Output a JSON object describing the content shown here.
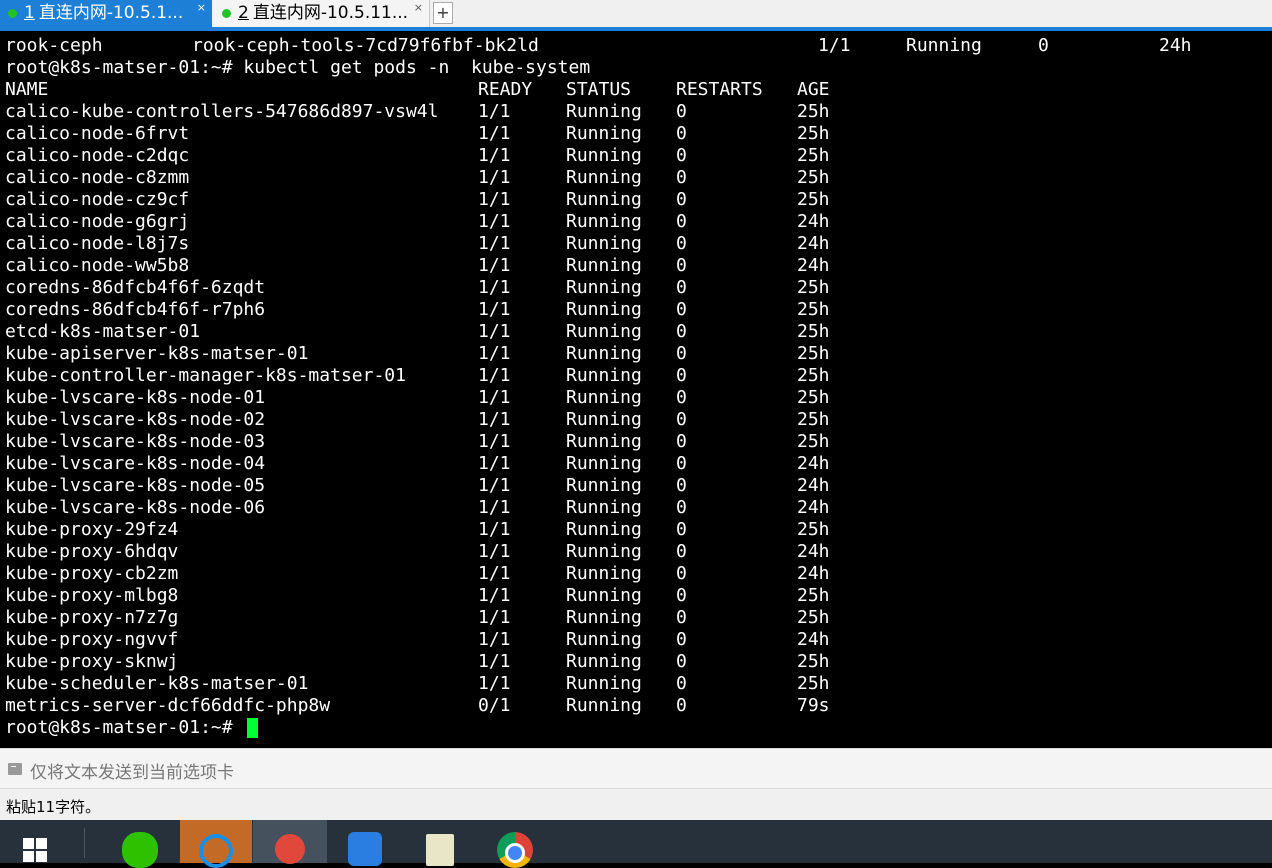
{
  "tabs": [
    {
      "num": "1",
      "title": "直连内网-10.5.1...",
      "close": "×"
    },
    {
      "num": "2",
      "title": "直连内网-10.5.11...",
      "close": "×"
    }
  ],
  "add_tab_label": "+",
  "terminal": {
    "rook_row": [
      "rook-ceph",
      "rook-ceph-tools-7cd79f6fbf-bk2ld",
      "1/1",
      "Running",
      "0",
      "24h"
    ],
    "command": "root@k8s-matser-01:~# kubectl get pods -n  kube-system",
    "headers": [
      "NAME",
      "READY",
      "STATUS",
      "RESTARTS",
      "AGE"
    ],
    "rows": [
      [
        "calico-kube-controllers-547686d897-vsw4l",
        "1/1",
        "Running",
        "0",
        "25h"
      ],
      [
        "calico-node-6frvt",
        "1/1",
        "Running",
        "0",
        "25h"
      ],
      [
        "calico-node-c2dqc",
        "1/1",
        "Running",
        "0",
        "25h"
      ],
      [
        "calico-node-c8zmm",
        "1/1",
        "Running",
        "0",
        "25h"
      ],
      [
        "calico-node-cz9cf",
        "1/1",
        "Running",
        "0",
        "25h"
      ],
      [
        "calico-node-g6grj",
        "1/1",
        "Running",
        "0",
        "24h"
      ],
      [
        "calico-node-l8j7s",
        "1/1",
        "Running",
        "0",
        "24h"
      ],
      [
        "calico-node-ww5b8",
        "1/1",
        "Running",
        "0",
        "24h"
      ],
      [
        "coredns-86dfcb4f6f-6zqdt",
        "1/1",
        "Running",
        "0",
        "25h"
      ],
      [
        "coredns-86dfcb4f6f-r7ph6",
        "1/1",
        "Running",
        "0",
        "25h"
      ],
      [
        "etcd-k8s-matser-01",
        "1/1",
        "Running",
        "0",
        "25h"
      ],
      [
        "kube-apiserver-k8s-matser-01",
        "1/1",
        "Running",
        "0",
        "25h"
      ],
      [
        "kube-controller-manager-k8s-matser-01",
        "1/1",
        "Running",
        "0",
        "25h"
      ],
      [
        "kube-lvscare-k8s-node-01",
        "1/1",
        "Running",
        "0",
        "25h"
      ],
      [
        "kube-lvscare-k8s-node-02",
        "1/1",
        "Running",
        "0",
        "25h"
      ],
      [
        "kube-lvscare-k8s-node-03",
        "1/1",
        "Running",
        "0",
        "25h"
      ],
      [
        "kube-lvscare-k8s-node-04",
        "1/1",
        "Running",
        "0",
        "24h"
      ],
      [
        "kube-lvscare-k8s-node-05",
        "1/1",
        "Running",
        "0",
        "24h"
      ],
      [
        "kube-lvscare-k8s-node-06",
        "1/1",
        "Running",
        "0",
        "24h"
      ],
      [
        "kube-proxy-29fz4",
        "1/1",
        "Running",
        "0",
        "25h"
      ],
      [
        "kube-proxy-6hdqv",
        "1/1",
        "Running",
        "0",
        "24h"
      ],
      [
        "kube-proxy-cb2zm",
        "1/1",
        "Running",
        "0",
        "24h"
      ],
      [
        "kube-proxy-mlbg8",
        "1/1",
        "Running",
        "0",
        "25h"
      ],
      [
        "kube-proxy-n7z7g",
        "1/1",
        "Running",
        "0",
        "25h"
      ],
      [
        "kube-proxy-ngvvf",
        "1/1",
        "Running",
        "0",
        "24h"
      ],
      [
        "kube-proxy-sknwj",
        "1/1",
        "Running",
        "0",
        "25h"
      ],
      [
        "kube-scheduler-k8s-matser-01",
        "1/1",
        "Running",
        "0",
        "25h"
      ],
      [
        "metrics-server-dcf66ddfc-php8w",
        "0/1",
        "Running",
        "0",
        "79s"
      ]
    ],
    "prompt": "root@k8s-matser-01:~# "
  },
  "send_bar": {
    "placeholder": "仅将文本发送到当前选项卡"
  },
  "status_bar": {
    "text": "粘贴11字符。"
  },
  "taskbar": {
    "icons": [
      "windows-start-icon",
      "wechat-icon",
      "chat-app-icon",
      "terminal-app-icon",
      "upload-app-icon",
      "notepad-app-icon",
      "chrome-icon"
    ]
  },
  "colors": {
    "tab_active": "#1e7fd6",
    "cursor": "#00ff33",
    "terminal_bg": "#000000",
    "taskbar": "#26313c"
  }
}
